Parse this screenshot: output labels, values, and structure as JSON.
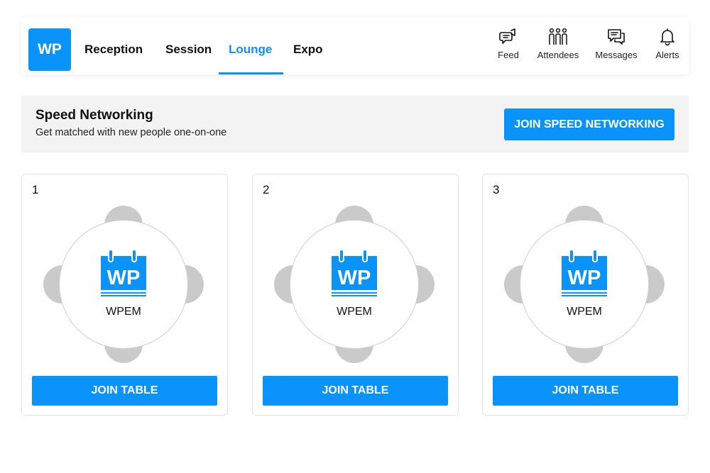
{
  "header": {
    "logo_text": "WP",
    "tabs": [
      {
        "label": "Reception",
        "active": false
      },
      {
        "label": "Session",
        "active": false
      },
      {
        "label": "Lounge",
        "active": true
      },
      {
        "label": "Expo",
        "active": false
      }
    ],
    "actions": [
      {
        "label": "Feed",
        "icon": "feed-icon"
      },
      {
        "label": "Attendees",
        "icon": "attendees-icon"
      },
      {
        "label": "Messages",
        "icon": "messages-icon"
      },
      {
        "label": "Alerts",
        "icon": "bell-icon"
      }
    ]
  },
  "banner": {
    "title": "Speed Networking",
    "subtitle": "Get matched with new people one-on-one",
    "button_label": "JOIN SPEED NETWORKING"
  },
  "tables": [
    {
      "number": "1",
      "logo_text": "WP",
      "name": "WPEM",
      "button_label": "JOIN TABLE"
    },
    {
      "number": "2",
      "logo_text": "WP",
      "name": "WPEM",
      "button_label": "JOIN TABLE"
    },
    {
      "number": "3",
      "logo_text": "WP",
      "name": "WPEM",
      "button_label": "JOIN TABLE"
    }
  ],
  "colors": {
    "accent": "#0a93fb",
    "banner_bg": "#f3f3f3",
    "seat": "#cacaca"
  }
}
